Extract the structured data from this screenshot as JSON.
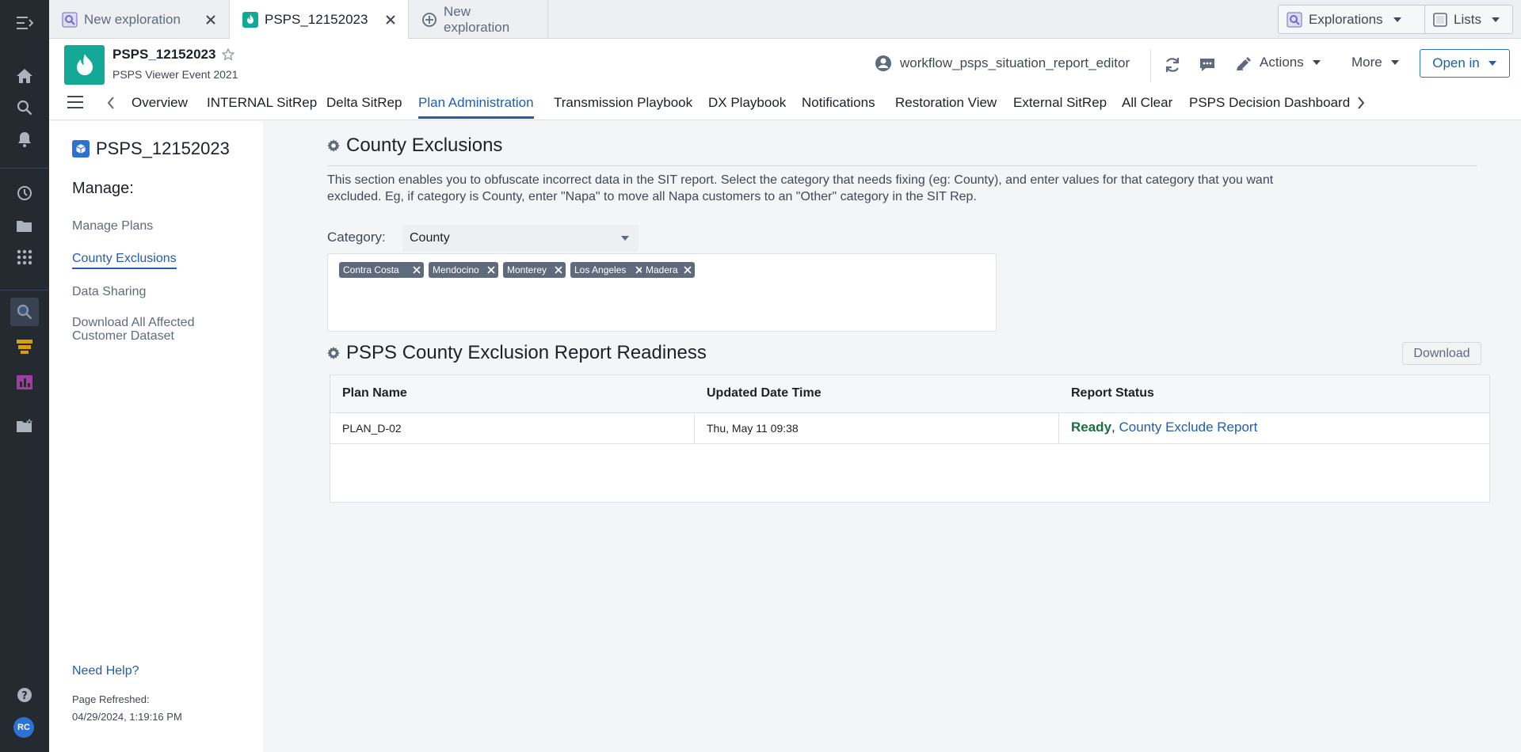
{
  "tabs": [
    {
      "label": "New exploration",
      "icon": "search-doc-icon",
      "active": false,
      "closable": true
    },
    {
      "label": "PSPS_12152023",
      "icon": "flame-icon",
      "active": true,
      "closable": true
    },
    {
      "label": "New exploration",
      "icon": "add-circle-icon",
      "active": false,
      "closable": false
    }
  ],
  "toolbar": {
    "explorations_label": "Explorations",
    "lists_label": "Lists"
  },
  "header": {
    "title": "PSPS_12152023",
    "subtitle": "PSPS Viewer Event 2021",
    "role": "workflow_psps_situation_report_editor",
    "actions_label": "Actions",
    "more_label": "More",
    "open_in_label": "Open in"
  },
  "nav": {
    "tabs": [
      "Overview",
      "INTERNAL SitRep",
      "Delta SitRep",
      "Plan Administration",
      "Transmission Playbook",
      "DX Playbook",
      "Notifications",
      "Restoration View",
      "External SitRep",
      "All Clear",
      "PSPS Decision Dashboard"
    ],
    "active": "Plan Administration"
  },
  "sidebar": {
    "title": "PSPS_12152023",
    "manage_label": "Manage:",
    "items": [
      "Manage Plans",
      "County Exclusions",
      "Data Sharing",
      "Download All Affected Customer Dataset"
    ],
    "active": "County Exclusions",
    "help_label": "Need Help?",
    "refresh_label": "Page Refreshed:",
    "refresh_time": "04/29/2024, 1:19:16 PM"
  },
  "exclusions": {
    "title": "County Exclusions",
    "description": "This section enables you to obfuscate incorrect data in the SIT report. Select the category that needs fixing (eg: County), and enter values for that category that you want excluded. Eg, if category is County, enter \"Napa\" to move all Napa customers to an \"Other\" category in the SIT Rep.",
    "category_label": "Category:",
    "category_value": "County",
    "tags": [
      "Contra Costa",
      "Mendocino",
      "Monterey",
      "Los Angeles",
      "Madera"
    ]
  },
  "readiness": {
    "title": "PSPS County Exclusion Report Readiness",
    "download_label": "Download",
    "columns": [
      "Plan Name",
      "Updated Date Time",
      "Report Status"
    ],
    "rows": [
      {
        "plan": "PLAN_D-02",
        "updated": "Thu, May 11 09:38",
        "status": "Ready",
        "separator": ", ",
        "report_link": "County Exclude Report"
      }
    ]
  },
  "rail": {
    "avatar_initials": "RC"
  },
  "colors": {
    "accent": "#215db0",
    "rail": "#252a31",
    "logo": "#14a896",
    "ready": "#1c6e42"
  }
}
